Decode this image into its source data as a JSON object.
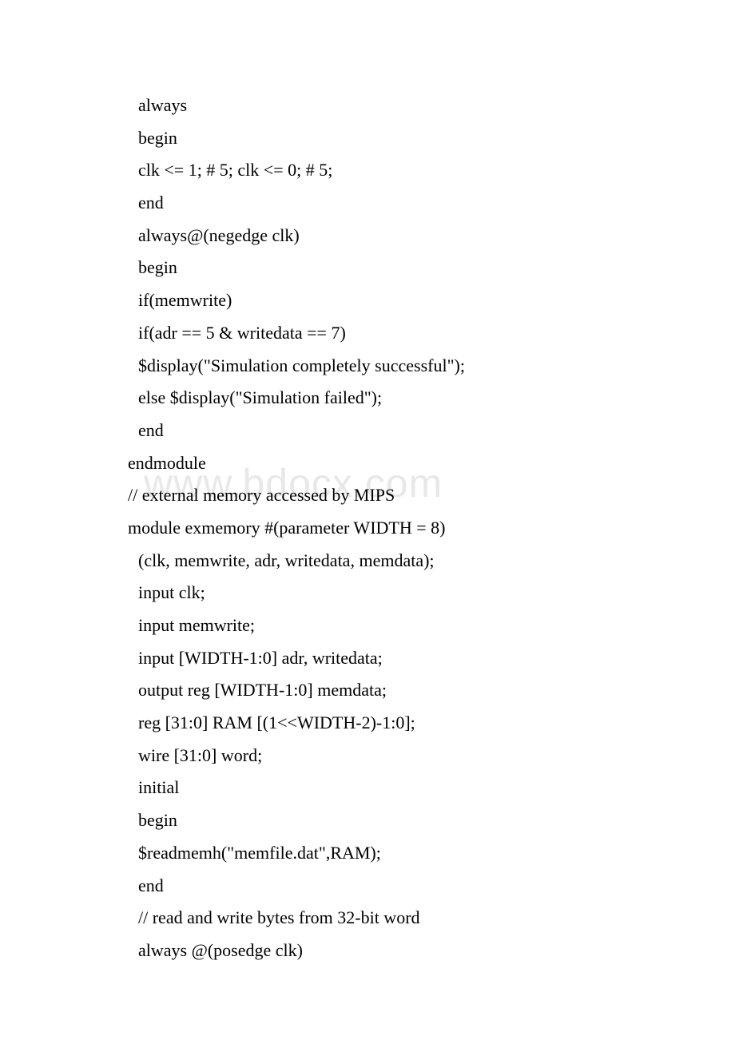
{
  "watermark": "www.bdocx.com",
  "code": {
    "lines": [
      {
        "text": "always",
        "indent": true
      },
      {
        "text": "begin",
        "indent": true
      },
      {
        "text": "clk <= 1; # 5; clk <= 0; # 5;",
        "indent": true
      },
      {
        "text": "end",
        "indent": true
      },
      {
        "text": "always@(negedge clk)",
        "indent": true
      },
      {
        "text": "begin",
        "indent": true
      },
      {
        "text": "if(memwrite)",
        "indent": true
      },
      {
        "text": "if(adr == 5 & writedata == 7)",
        "indent": true
      },
      {
        "text": "$display(\"Simulation completely successful\");",
        "indent": true
      },
      {
        "text": "else $display(\"Simulation failed\");",
        "indent": true
      },
      {
        "text": "end",
        "indent": true
      },
      {
        "text": "endmodule",
        "indent": false
      },
      {
        "text": "// external memory accessed by MIPS",
        "indent": false
      },
      {
        "text": "module exmemory #(parameter WIDTH = 8)",
        "indent": false
      },
      {
        "text": "(clk, memwrite, adr, writedata, memdata);",
        "indent": true
      },
      {
        "text": "input clk;",
        "indent": true
      },
      {
        "text": "input memwrite;",
        "indent": true
      },
      {
        "text": "input [WIDTH-1:0] adr, writedata;",
        "indent": true
      },
      {
        "text": "output reg [WIDTH-1:0] memdata;",
        "indent": true
      },
      {
        "text": "reg [31:0] RAM [(1<<WIDTH-2)-1:0];",
        "indent": true
      },
      {
        "text": "wire [31:0] word;",
        "indent": true
      },
      {
        "text": "initial",
        "indent": true
      },
      {
        "text": "begin",
        "indent": true
      },
      {
        "text": "$readmemh(\"memfile.dat\",RAM);",
        "indent": true
      },
      {
        "text": "end",
        "indent": true
      },
      {
        "text": "// read and write bytes from 32-bit word",
        "indent": true
      },
      {
        "text": "always @(posedge clk)",
        "indent": true
      }
    ]
  }
}
